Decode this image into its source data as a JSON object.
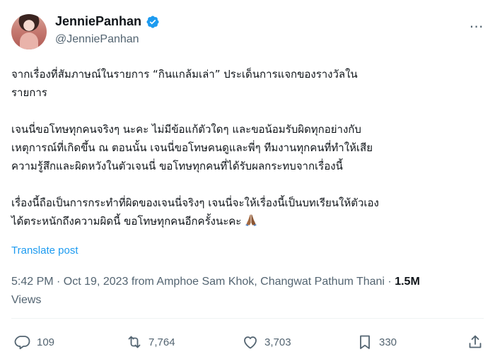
{
  "author": {
    "display_name": "JenniePanhan",
    "handle": "@JenniePanhan"
  },
  "post": {
    "paragraphs": [
      "จากเรื่องที่สัมภาษณ์ในรายการ “กินแกล้มเล่า”  ประเด็นการแจกของรางวัลใน\nรายการ",
      "เจนนี่ขอโทษทุกคนจริงๆ นะคะ ไม่มีข้อแก้ตัวใดๆ และขอน้อมรับผิดทุกอย่างกับ\nเหตุการณ์ที่เกิดขึ้น ณ ตอนนั้น เจนนี่ขอโทษคนดูและพี่ๆ ทีมงานทุกคนที่ทำให้เสีย\nความรู้สึกและผิดหวังในตัวเจนนี่ ขอโทษทุกคนที่ได้รับผลกระทบจากเรื่องนี้",
      "เรื่องนี้ถือเป็นการกระทำที่ผิดของเจนนี่จริงๆ เจนนี่จะให้เรื่องนี้เป็นบทเรียนให้ตัวเอง\nได้ตระหนักถึงความผิดนี้ ขอโทษทุกคนอีกครั้งนะคะ"
    ],
    "emoji": "folded-hands-emoji",
    "translate_label": "Translate post"
  },
  "meta": {
    "timestamp": "5:42 PM · Oct 19, 2023 from Amphoe Sam Khok, Changwat Pathum Thani · ",
    "views_count": "1.5M",
    "views_label": "Views"
  },
  "actions": {
    "replies": "109",
    "reposts": "7,764",
    "likes": "3,703",
    "bookmarks": "330"
  },
  "colors": {
    "accent": "#1d9bf0",
    "text": "#0f1419",
    "secondary": "#536471"
  }
}
